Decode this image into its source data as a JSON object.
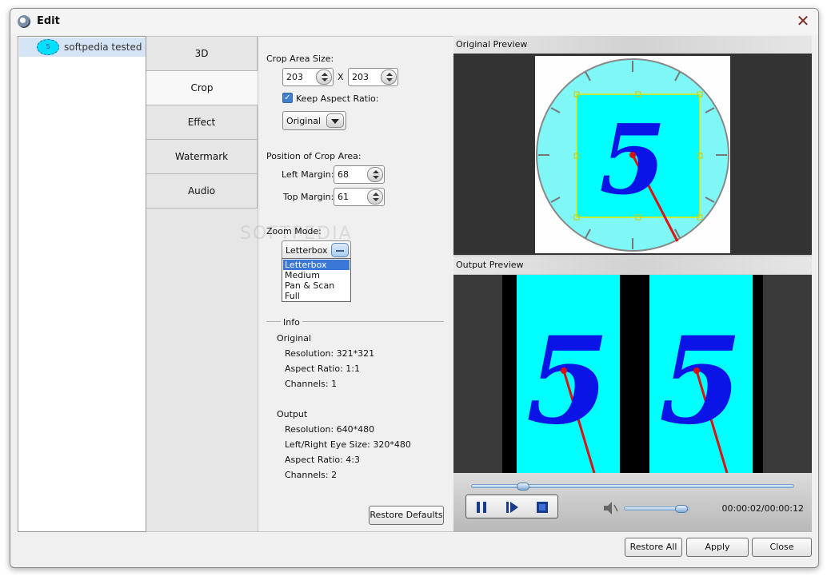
{
  "window": {
    "title": "Edit"
  },
  "file_list": {
    "items": [
      {
        "label": "softpedia tested",
        "thumb_text": "5"
      }
    ]
  },
  "tabs": [
    {
      "label": "3D",
      "active": false
    },
    {
      "label": "Crop",
      "active": true
    },
    {
      "label": "Effect",
      "active": false
    },
    {
      "label": "Watermark",
      "active": false
    },
    {
      "label": "Audio",
      "active": false
    }
  ],
  "crop": {
    "area_size_label": "Crop Area Size:",
    "width": "203",
    "height": "203",
    "x_sep": "X",
    "keep_aspect_label": "Keep Aspect Ratio:",
    "keep_aspect_checked": true,
    "aspect_value": "Original",
    "position_label": "Position of Crop Area:",
    "left_margin_label": "Left Margin:",
    "left_margin": "68",
    "top_margin_label": "Top Margin:",
    "top_margin": "61",
    "zoom_label": "Zoom Mode:",
    "zoom_value": "Letterbox",
    "zoom_options": [
      "Letterbox",
      "Medium",
      "Pan & Scan",
      "Full"
    ]
  },
  "info": {
    "title": "Info",
    "original_heading": "Original",
    "original": {
      "resolution": "Resolution: 321*321",
      "aspect": "Aspect Ratio: 1:1",
      "channels": "Channels: 1"
    },
    "output_heading": "Output",
    "output": {
      "resolution": "Resolution: 640*480",
      "eye_size": "Left/Right Eye Size: 320*480",
      "aspect": "Aspect Ratio: 4:3",
      "channels": "Channels: 2"
    }
  },
  "buttons": {
    "restore_defaults": "Restore Defaults",
    "restore_all": "Restore All",
    "apply": "Apply",
    "close": "Close"
  },
  "preview": {
    "original_label": "Original Preview",
    "output_label": "Output Preview",
    "frame_digit": "5",
    "time": "00:00:02/00:00:12",
    "progress": 0.16,
    "volume": 0.88
  },
  "watermark_text": "SOFTPEDIA",
  "colors": {
    "cyan": "#00ffff",
    "digit": "#0a14e6",
    "hand": "#dd1111",
    "accent": "#3a77d6"
  }
}
